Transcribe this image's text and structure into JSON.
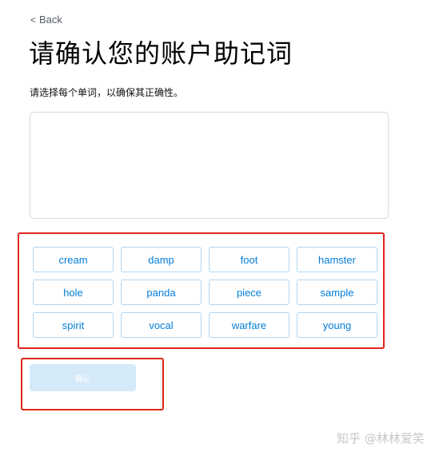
{
  "back": {
    "chevron": "<",
    "label": "Back"
  },
  "page_title": "请确认您的账户助记词",
  "instruction": "请选择每个单词，以确保其正确性。",
  "word_options": [
    "cream",
    "damp",
    "foot",
    "hamster",
    "hole",
    "panda",
    "piece",
    "sample",
    "spirit",
    "vocal",
    "warfare",
    "young"
  ],
  "confirm_button": {
    "label": "确认",
    "state": "disabled"
  },
  "watermark": "知乎 @林林爱笑",
  "colors": {
    "accent": "#037dd6",
    "word_border": "#b2d7f2",
    "button_disabled_bg": "#d4eaf9",
    "annotation_red": "#e2231a"
  }
}
